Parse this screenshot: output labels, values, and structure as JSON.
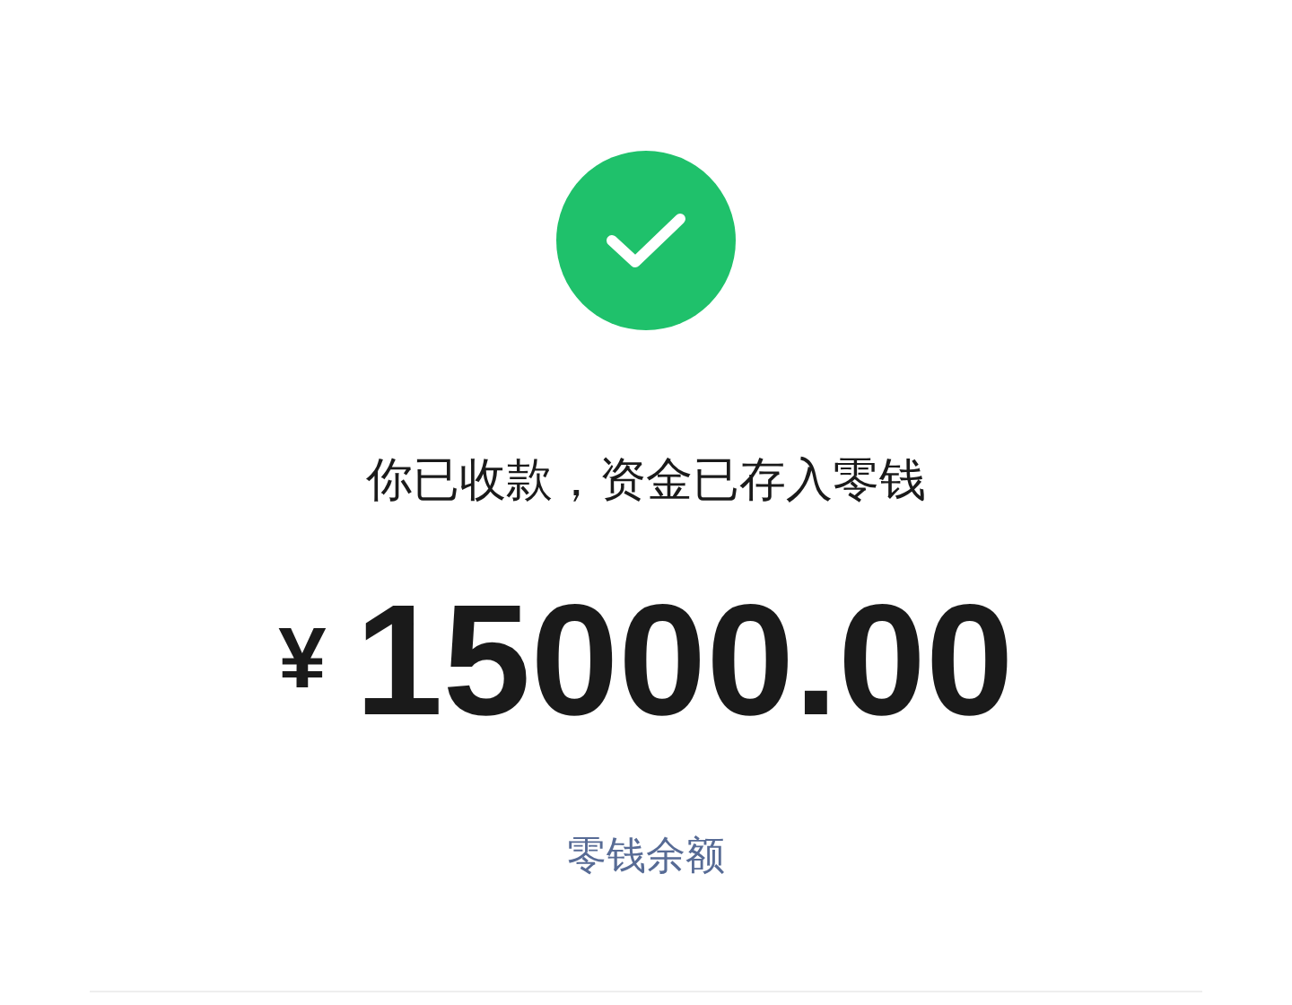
{
  "status": {
    "message": "你已收款，资金已存入零钱"
  },
  "amount": {
    "currency": "¥",
    "value": "15000.00"
  },
  "link": {
    "label": "零钱余额"
  }
}
